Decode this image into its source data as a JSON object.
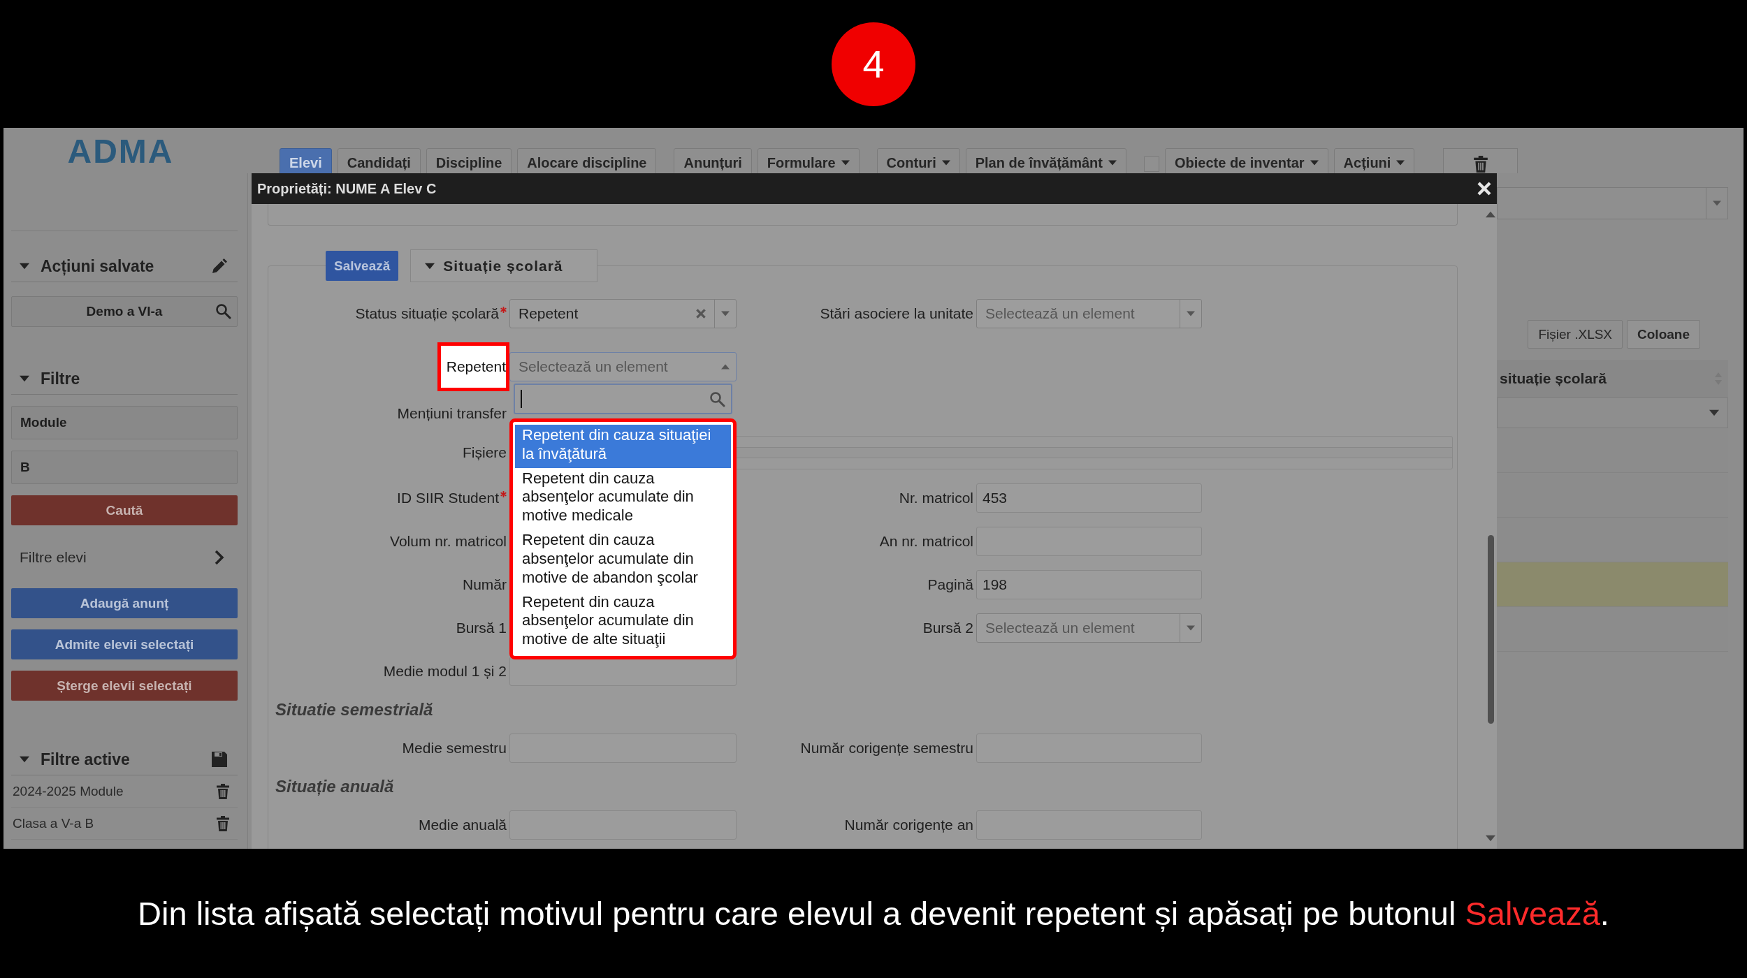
{
  "step_badge": "4",
  "app": {
    "logo": "ADMA",
    "nav_groups": [
      {
        "tabs": [
          {
            "label": "Elevi",
            "selected": true,
            "menu": false
          },
          {
            "label": "Candidați",
            "selected": false,
            "menu": false
          },
          {
            "label": "Discipline",
            "selected": false,
            "menu": false
          },
          {
            "label": "Alocare discipline",
            "selected": false,
            "menu": false
          }
        ]
      },
      {
        "tabs": [
          {
            "label": "Anunțuri",
            "selected": false,
            "menu": false
          },
          {
            "label": "Formulare",
            "selected": false,
            "menu": true
          }
        ]
      },
      {
        "tabs": [
          {
            "label": "Conturi",
            "selected": false,
            "menu": true
          },
          {
            "label": "Plan de învățământ",
            "selected": false,
            "menu": true
          }
        ]
      },
      {
        "tabs": [
          {
            "label": "Obiecte de inventar",
            "selected": false,
            "menu": true
          },
          {
            "label": "Acțiuni",
            "selected": false,
            "menu": true
          }
        ]
      }
    ],
    "sidebar": {
      "saved_actions": {
        "title": "Acțiuni salvate",
        "expanded": true,
        "search_value": "Demo a VI-a"
      },
      "filters": {
        "title": "Filtre",
        "expanded": true,
        "fields": [
          "Module",
          "B"
        ],
        "search_button": "Caută",
        "student_filters": "Filtre elevi",
        "actions": [
          {
            "label": "Adaugă anunț",
            "kind": "primary"
          },
          {
            "label": "Admite elevii selectați",
            "kind": "primary"
          },
          {
            "label": "Șterge elevii selectați",
            "kind": "danger"
          }
        ]
      },
      "active_filters": {
        "title": "Filtre active",
        "expanded": true,
        "items": [
          "2024-2025 Module",
          "Clasa a V-a B"
        ]
      }
    },
    "table": {
      "toolbar_buttons": [
        {
          "label": "Fișier .XLSX",
          "emphasized": false
        },
        {
          "label": "Coloane",
          "emphasized": true
        }
      ],
      "column_header": "situație școlară",
      "rows": [
        {
          "highlighted": false
        },
        {
          "highlighted": false
        },
        {
          "highlighted": false
        },
        {
          "highlighted": true
        },
        {
          "highlighted": false
        }
      ]
    },
    "dialog": {
      "title": "Proprietăți: NUME A Elev C",
      "save_button": "Salvează",
      "section_tab": {
        "label": "Situație școlară",
        "expanded": true
      },
      "form": [
        {
          "kind": "row",
          "left": {
            "label": "Status situație școlară",
            "required": true,
            "highlighted": false,
            "kind": "select",
            "value": "Repetent",
            "clearable": true
          },
          "right": {
            "label": "Stări asociere la unitate",
            "required": false,
            "highlighted": false,
            "kind": "select",
            "placeholder": "Selectează un element",
            "clearable": false
          }
        },
        {
          "kind": "row",
          "left": {
            "label": "Repetent",
            "required": false,
            "highlighted": true,
            "kind": "select_open",
            "placeholder": "Selectează un element",
            "clearable": false,
            "options": [
              {
                "label": "Repetent din cauza situaţiei la învăţătură",
                "selected": true
              },
              {
                "label": "Repetent din cauza absenţelor acumulate din motive medicale",
                "selected": false
              },
              {
                "label": "Repetent din cauza absenţelor acumulate din motive de abandon şcolar",
                "selected": false
              },
              {
                "label": "Repetent din cauza absenţelor acumulate din motive de alte situaţii",
                "selected": false
              }
            ]
          }
        },
        {
          "kind": "row",
          "left": {
            "label": "Mențiuni transfer",
            "required": false,
            "highlighted": false,
            "kind": "covered"
          }
        },
        {
          "kind": "row",
          "left": {
            "label": "Fișiere",
            "required": false,
            "highlighted": false,
            "kind": "wide"
          }
        },
        {
          "kind": "row",
          "left": {
            "label": "ID SIIR Student",
            "required": true,
            "highlighted": false,
            "kind": "covered"
          },
          "right": {
            "label": "Nr. matricol",
            "required": false,
            "highlighted": false,
            "kind": "text",
            "value": "453"
          }
        },
        {
          "kind": "row",
          "left": {
            "label": "Volum nr. matricol",
            "required": false,
            "highlighted": false,
            "kind": "covered"
          },
          "right": {
            "label": "An nr. matricol",
            "required": false,
            "highlighted": false,
            "kind": "text"
          }
        },
        {
          "kind": "row",
          "left": {
            "label": "Număr",
            "required": false,
            "highlighted": false,
            "kind": "covered"
          },
          "right": {
            "label": "Pagină",
            "required": false,
            "highlighted": false,
            "kind": "text",
            "value": "198"
          }
        },
        {
          "kind": "row",
          "left": {
            "label": "Bursă 1",
            "required": false,
            "highlighted": false,
            "kind": "covered"
          },
          "right": {
            "label": "Bursă 2",
            "required": false,
            "highlighted": false,
            "kind": "select",
            "placeholder": "Selectează un element",
            "clearable": false
          }
        },
        {
          "kind": "row",
          "left": {
            "label": "Medie modul 1 și 2",
            "required": false,
            "highlighted": false,
            "kind": "text"
          }
        },
        {
          "kind": "heading",
          "text": "Situatie semestrială"
        },
        {
          "kind": "row",
          "left": {
            "label": "Medie semestru",
            "required": false,
            "highlighted": false,
            "kind": "text"
          },
          "right": {
            "label": "Număr corigențe semestru",
            "required": false,
            "highlighted": false,
            "kind": "text"
          }
        },
        {
          "kind": "heading",
          "text": "Situație anuală"
        },
        {
          "kind": "row",
          "left": {
            "label": "Medie anuală",
            "required": false,
            "highlighted": false,
            "kind": "text"
          },
          "right": {
            "label": "Număr corigențe an",
            "required": false,
            "highlighted": false,
            "kind": "text"
          }
        }
      ]
    }
  },
  "caption": [
    {
      "text": "Din lista afișată selectați motivul pentru care elevul a devenit repetent și apăsați pe butonul ",
      "highlighted": false
    },
    {
      "text": "Salvează",
      "highlighted": true
    },
    {
      "text": ".",
      "highlighted": false
    }
  ]
}
